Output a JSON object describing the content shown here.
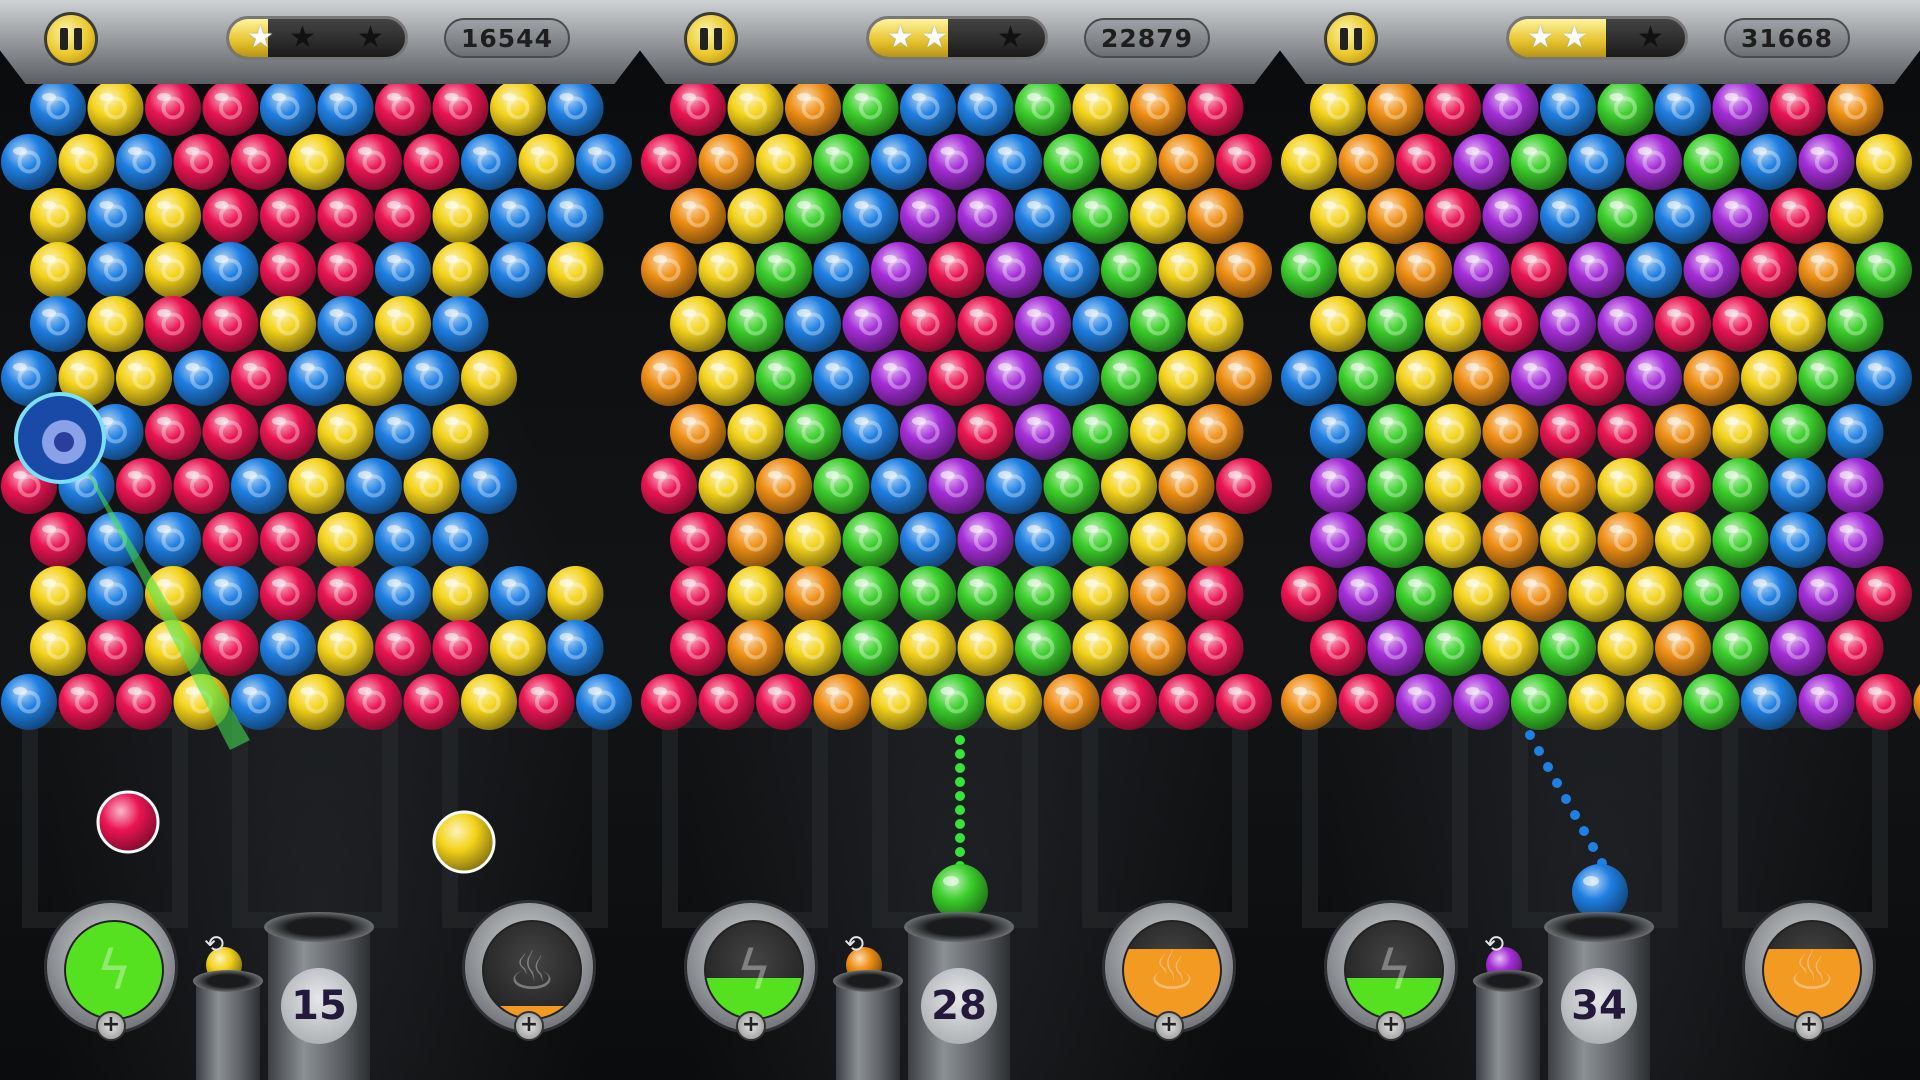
{
  "palette": {
    "red": "#ea1552",
    "yellow": "#f4d31b",
    "blue": "#1f7fe2",
    "green": "#3ccf2c",
    "orange": "#ef8f15",
    "purple": "#a52ed8"
  },
  "panels": [
    {
      "id": "panel-1",
      "hud": {
        "pause_icon": "pause-icon",
        "stars_filled": 1,
        "stars_total": 3,
        "star_progress": 0.22,
        "score": "16544"
      },
      "shots_left": "15",
      "current_bubble": "red",
      "next_bubble": "yellow",
      "power": {
        "icon": "lightning-icon",
        "level": 1.0,
        "color": "#55e11f"
      },
      "power2": {
        "icon": "flame-icon",
        "level": 0.12,
        "color": "#f39a23"
      },
      "projectile": "blue-spiral"
    },
    {
      "id": "panel-2",
      "hud": {
        "pause_icon": "pause-icon",
        "stars_filled": 2,
        "stars_total": 3,
        "star_progress": 0.45,
        "score": "22879"
      },
      "shots_left": "28",
      "current_bubble": "green",
      "next_bubble": "orange",
      "power": {
        "icon": "lightning-icon",
        "level": 0.42,
        "color": "#55e11f"
      },
      "power2": {
        "icon": "flame-icon",
        "level": 0.72,
        "color": "#f39a23"
      },
      "aim_color": "#35e33a"
    },
    {
      "id": "panel-3",
      "hud": {
        "pause_icon": "pause-icon",
        "stars_filled": 2,
        "stars_total": 3,
        "star_progress": 0.55,
        "score": "31668"
      },
      "shots_left": "34",
      "current_bubble": "blue",
      "next_bubble": "purple",
      "power": {
        "icon": "lightning-icon",
        "level": 0.42,
        "color": "#55e11f"
      },
      "power2": {
        "icon": "flame-icon",
        "level": 0.72,
        "color": "#f39a23"
      },
      "aim_color": "#1f7fe2"
    }
  ],
  "grids": [
    [
      "BYRRBBRRYB",
      "BYBRRYRRBYB",
      "YBYRRRRYBB",
      "YBYBRRBYBY",
      "BYRRYBYB",
      "BYYBRBYBY",
      "YBRRRYBY",
      "RBRRBYBYB",
      "RBBRRYBB",
      "YBYBRRBYBY",
      "YRYRBYRRYB",
      "BRRYBYRRYRB"
    ],
    [
      "RYOGBBGYOR",
      "ROYGBPBGYOR",
      "OYGBPPBGYO",
      "OYGBPRPBGYO",
      "YGBPRRPBGY",
      "OYGBPRPBGYO",
      "OYGBPRPGYO",
      "RYOGBPBGYOR",
      "ROYGBPBGYO",
      "RYOGGGGYOR",
      "ROYGYYGYOR",
      "RRROYGYORRR"
    ],
    [
      "YORPBGBPRO",
      "YORPGBPGBPY",
      "YORPBGBPRY",
      "GYOPRPBPROG",
      "YGYRPPRRYG",
      "BGYOPRPOYGB",
      "BGYORROYGB",
      "PGYROYRGBP",
      "PGYOYOYGBP",
      "RPGYOYYGBPR",
      "RPGYGYOGPR",
      "ORPPGYYGBPRO"
    ]
  ]
}
